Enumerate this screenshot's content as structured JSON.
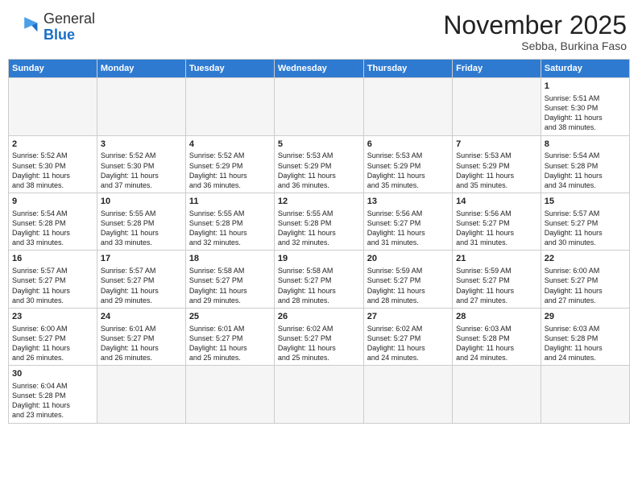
{
  "logo": {
    "general": "General",
    "blue": "Blue"
  },
  "header": {
    "month": "November 2025",
    "location": "Sebba, Burkina Faso"
  },
  "days_of_week": [
    "Sunday",
    "Monday",
    "Tuesday",
    "Wednesday",
    "Thursday",
    "Friday",
    "Saturday"
  ],
  "weeks": [
    [
      {
        "day": "",
        "info": ""
      },
      {
        "day": "",
        "info": ""
      },
      {
        "day": "",
        "info": ""
      },
      {
        "day": "",
        "info": ""
      },
      {
        "day": "",
        "info": ""
      },
      {
        "day": "",
        "info": ""
      },
      {
        "day": "1",
        "info": "Sunrise: 5:51 AM\nSunset: 5:30 PM\nDaylight: 11 hours\nand 38 minutes."
      }
    ],
    [
      {
        "day": "2",
        "info": "Sunrise: 5:52 AM\nSunset: 5:30 PM\nDaylight: 11 hours\nand 38 minutes."
      },
      {
        "day": "3",
        "info": "Sunrise: 5:52 AM\nSunset: 5:30 PM\nDaylight: 11 hours\nand 37 minutes."
      },
      {
        "day": "4",
        "info": "Sunrise: 5:52 AM\nSunset: 5:29 PM\nDaylight: 11 hours\nand 36 minutes."
      },
      {
        "day": "5",
        "info": "Sunrise: 5:53 AM\nSunset: 5:29 PM\nDaylight: 11 hours\nand 36 minutes."
      },
      {
        "day": "6",
        "info": "Sunrise: 5:53 AM\nSunset: 5:29 PM\nDaylight: 11 hours\nand 35 minutes."
      },
      {
        "day": "7",
        "info": "Sunrise: 5:53 AM\nSunset: 5:29 PM\nDaylight: 11 hours\nand 35 minutes."
      },
      {
        "day": "8",
        "info": "Sunrise: 5:54 AM\nSunset: 5:28 PM\nDaylight: 11 hours\nand 34 minutes."
      }
    ],
    [
      {
        "day": "9",
        "info": "Sunrise: 5:54 AM\nSunset: 5:28 PM\nDaylight: 11 hours\nand 33 minutes."
      },
      {
        "day": "10",
        "info": "Sunrise: 5:55 AM\nSunset: 5:28 PM\nDaylight: 11 hours\nand 33 minutes."
      },
      {
        "day": "11",
        "info": "Sunrise: 5:55 AM\nSunset: 5:28 PM\nDaylight: 11 hours\nand 32 minutes."
      },
      {
        "day": "12",
        "info": "Sunrise: 5:55 AM\nSunset: 5:28 PM\nDaylight: 11 hours\nand 32 minutes."
      },
      {
        "day": "13",
        "info": "Sunrise: 5:56 AM\nSunset: 5:27 PM\nDaylight: 11 hours\nand 31 minutes."
      },
      {
        "day": "14",
        "info": "Sunrise: 5:56 AM\nSunset: 5:27 PM\nDaylight: 11 hours\nand 31 minutes."
      },
      {
        "day": "15",
        "info": "Sunrise: 5:57 AM\nSunset: 5:27 PM\nDaylight: 11 hours\nand 30 minutes."
      }
    ],
    [
      {
        "day": "16",
        "info": "Sunrise: 5:57 AM\nSunset: 5:27 PM\nDaylight: 11 hours\nand 30 minutes."
      },
      {
        "day": "17",
        "info": "Sunrise: 5:57 AM\nSunset: 5:27 PM\nDaylight: 11 hours\nand 29 minutes."
      },
      {
        "day": "18",
        "info": "Sunrise: 5:58 AM\nSunset: 5:27 PM\nDaylight: 11 hours\nand 29 minutes."
      },
      {
        "day": "19",
        "info": "Sunrise: 5:58 AM\nSunset: 5:27 PM\nDaylight: 11 hours\nand 28 minutes."
      },
      {
        "day": "20",
        "info": "Sunrise: 5:59 AM\nSunset: 5:27 PM\nDaylight: 11 hours\nand 28 minutes."
      },
      {
        "day": "21",
        "info": "Sunrise: 5:59 AM\nSunset: 5:27 PM\nDaylight: 11 hours\nand 27 minutes."
      },
      {
        "day": "22",
        "info": "Sunrise: 6:00 AM\nSunset: 5:27 PM\nDaylight: 11 hours\nand 27 minutes."
      }
    ],
    [
      {
        "day": "23",
        "info": "Sunrise: 6:00 AM\nSunset: 5:27 PM\nDaylight: 11 hours\nand 26 minutes."
      },
      {
        "day": "24",
        "info": "Sunrise: 6:01 AM\nSunset: 5:27 PM\nDaylight: 11 hours\nand 26 minutes."
      },
      {
        "day": "25",
        "info": "Sunrise: 6:01 AM\nSunset: 5:27 PM\nDaylight: 11 hours\nand 25 minutes."
      },
      {
        "day": "26",
        "info": "Sunrise: 6:02 AM\nSunset: 5:27 PM\nDaylight: 11 hours\nand 25 minutes."
      },
      {
        "day": "27",
        "info": "Sunrise: 6:02 AM\nSunset: 5:27 PM\nDaylight: 11 hours\nand 24 minutes."
      },
      {
        "day": "28",
        "info": "Sunrise: 6:03 AM\nSunset: 5:28 PM\nDaylight: 11 hours\nand 24 minutes."
      },
      {
        "day": "29",
        "info": "Sunrise: 6:03 AM\nSunset: 5:28 PM\nDaylight: 11 hours\nand 24 minutes."
      }
    ],
    [
      {
        "day": "30",
        "info": "Sunrise: 6:04 AM\nSunset: 5:28 PM\nDaylight: 11 hours\nand 23 minutes."
      },
      {
        "day": "",
        "info": ""
      },
      {
        "day": "",
        "info": ""
      },
      {
        "day": "",
        "info": ""
      },
      {
        "day": "",
        "info": ""
      },
      {
        "day": "",
        "info": ""
      },
      {
        "day": "",
        "info": ""
      }
    ]
  ]
}
